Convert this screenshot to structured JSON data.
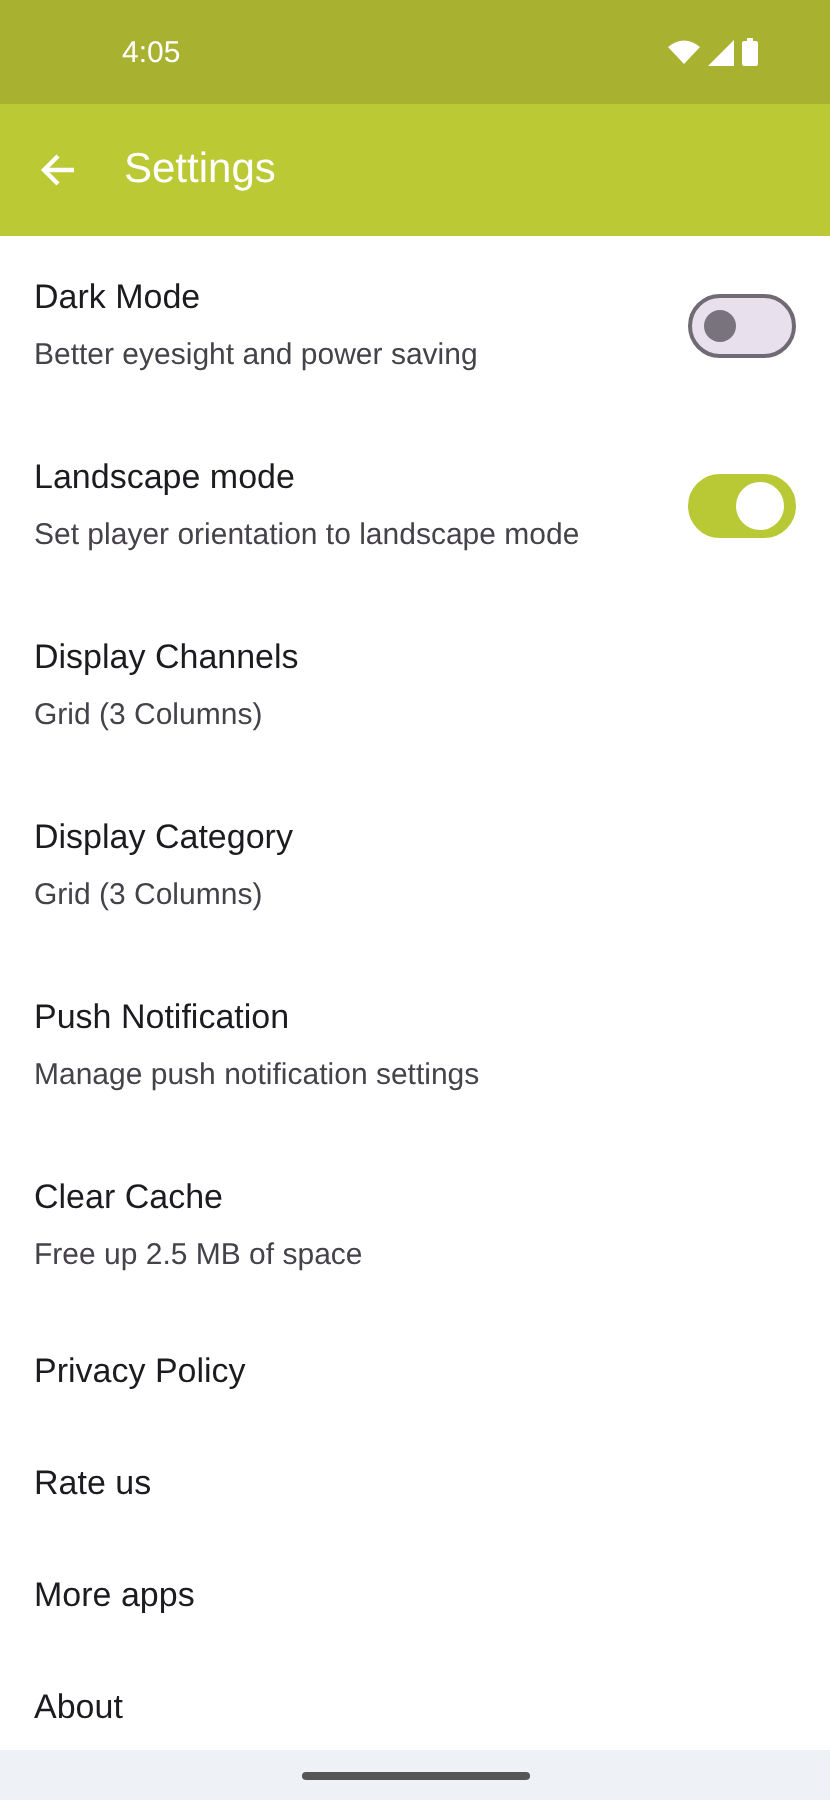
{
  "status_bar": {
    "time": "4:05"
  },
  "app_bar": {
    "title": "Settings"
  },
  "settings": [
    {
      "kind": "toggle",
      "title": "Dark Mode",
      "subtitle": "Better eyesight and power saving",
      "on": false
    },
    {
      "kind": "toggle",
      "title": "Landscape mode",
      "subtitle": "Set player orientation to landscape mode",
      "on": true
    },
    {
      "kind": "link",
      "title": "Display Channels",
      "subtitle": "Grid (3 Columns)"
    },
    {
      "kind": "link",
      "title": "Display Category",
      "subtitle": "Grid (3 Columns)"
    },
    {
      "kind": "link",
      "title": "Push Notification",
      "subtitle": "Manage push notification settings"
    },
    {
      "kind": "link",
      "title": "Clear Cache",
      "subtitle": "Free up 2.5 MB of space"
    },
    {
      "kind": "link",
      "title": "Privacy Policy"
    },
    {
      "kind": "link",
      "title": "Rate us"
    },
    {
      "kind": "link",
      "title": "More apps"
    },
    {
      "kind": "link",
      "title": "About"
    }
  ]
}
